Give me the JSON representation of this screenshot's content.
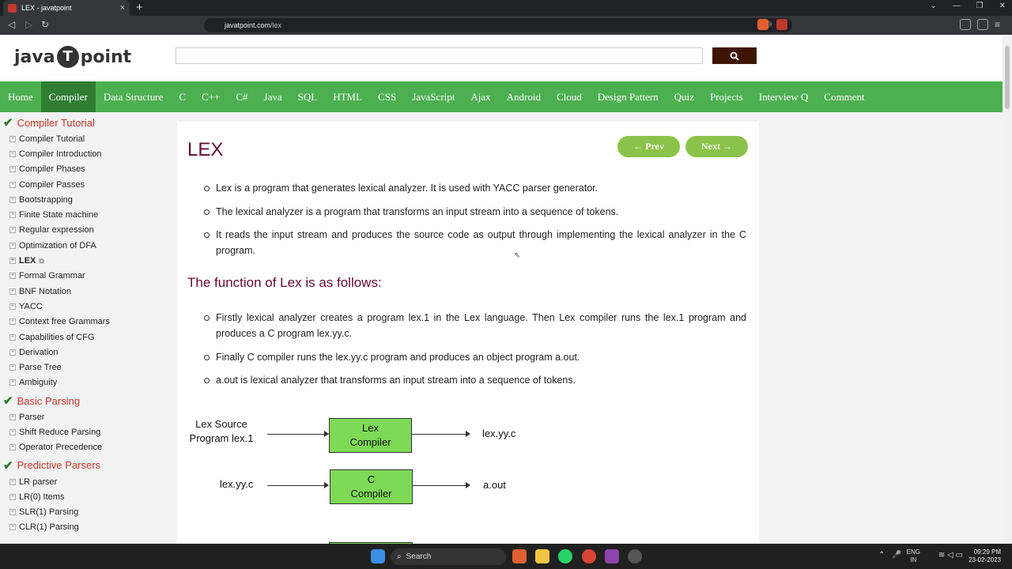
{
  "browser": {
    "tab_title": "LEX - javatpoint",
    "tab_close": "×",
    "new_tab": "+",
    "url_host": "javatpoint.com",
    "url_path": "/lex",
    "window_controls": [
      "⌄",
      "—",
      "❐",
      "✕"
    ]
  },
  "header": {
    "logo_left": "java",
    "logo_mid": "T",
    "logo_right": "point",
    "search_placeholder": "",
    "search_icon": "search-icon"
  },
  "menu": [
    "Home",
    "Compiler",
    "Data Structure",
    "C",
    "C++",
    "C#",
    "Java",
    "SQL",
    "HTML",
    "CSS",
    "JavaScript",
    "Ajax",
    "Android",
    "Cloud",
    "Design Pattern",
    "Quiz",
    "Projects",
    "Interview Q",
    "Comment"
  ],
  "menu_active": "Compiler",
  "sidebar": {
    "sections": [
      {
        "title": "Compiler Tutorial",
        "items": [
          "Compiler Tutorial",
          "Compiler Introduction",
          "Compiler Phases",
          "Compiler Passes",
          "Bootstrapping",
          "Finite State machine",
          "Regular expression",
          "Optimization of DFA",
          "LEX",
          "Formal Grammar",
          "BNF Notation",
          "YACC",
          "Context free Grammars",
          "Capabilities of CFG",
          "Derivation",
          "Parse Tree",
          "Ambiguity"
        ]
      },
      {
        "title": "Basic Parsing",
        "items": [
          "Parser",
          "Shift Reduce Parsing",
          "Operator Precedence"
        ]
      },
      {
        "title": "Predictive Parsers",
        "items": [
          "LR parser",
          "LR(0) Items",
          "SLR(1) Parsing",
          "CLR(1) Parsing"
        ]
      }
    ],
    "current": "LEX"
  },
  "article": {
    "title": "LEX",
    "prev_label": "← Prev",
    "next_label": "Next →",
    "bullets1": [
      "Lex is a program that generates lexical analyzer. It is used with YACC parser generator.",
      "The lexical analyzer is a program that transforms an input stream into a sequence of tokens.",
      "It reads the input stream and produces the source code as output through implementing the lexical analyzer in the C program."
    ],
    "subtitle": "The function of Lex is as follows:",
    "bullets2": [
      "Firstly lexical analyzer creates a program lex.1 in the Lex language. Then Lex compiler runs the lex.1 program and produces a C program lex.yy.c.",
      "Finally C compiler runs the lex.yy.c program and produces an object program a.out.",
      "a.out is lexical analyzer that transforms an input stream into a sequence of tokens."
    ]
  },
  "diagram": {
    "row1_input_line1": "Lex Source",
    "row1_input_line2": "Program lex.1",
    "row1_box_line1": "Lex",
    "row1_box_line2": "Compiler",
    "row1_output": "lex.yy.c",
    "row2_input": "lex.yy.c",
    "row2_box_line1": "C",
    "row2_box_line2": "Compiler",
    "row2_output": "a.out",
    "box_color": "#7ed957"
  },
  "taskbar": {
    "search_label": "Search",
    "lang_line1": "ENG",
    "lang_line2": "IN",
    "time": "09:29 PM",
    "date": "23-02-2023"
  },
  "colors": {
    "menu_green": "#4caf50",
    "menu_active": "#2e7d32",
    "title_color": "#610b38",
    "nav_button": "#8bc34a",
    "search_button": "#3e1503"
  }
}
